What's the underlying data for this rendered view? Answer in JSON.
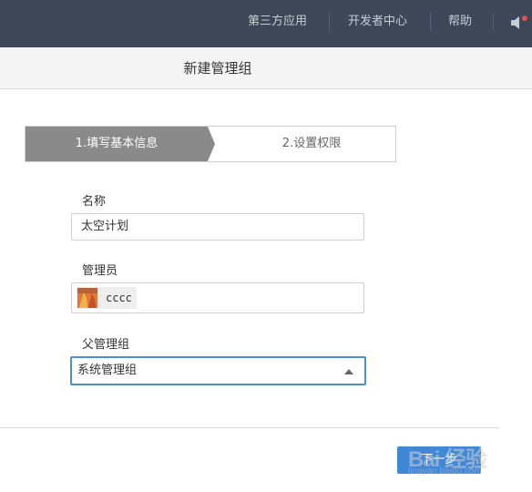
{
  "topnav": {
    "items": [
      {
        "label": "第三方应用"
      },
      {
        "label": "开发者中心"
      },
      {
        "label": "帮助"
      }
    ]
  },
  "title": "新建管理组",
  "steps": [
    {
      "label": "1.填写基本信息",
      "active": true
    },
    {
      "label": "2.设置权限",
      "active": false
    }
  ],
  "form": {
    "name_label": "名称",
    "name_value": "太空计划",
    "admin_label": "管理员",
    "admin_tag": "cccc",
    "parent_label": "父管理组",
    "parent_value": "系统管理组"
  },
  "next_button": "下一步",
  "watermark": {
    "main": "Bai 经验",
    "sub": "jingyan.baidu.com"
  },
  "colors": {
    "topbar": "#3e4758",
    "active_step": "#8a8a8a",
    "accent": "#4a90d9"
  }
}
